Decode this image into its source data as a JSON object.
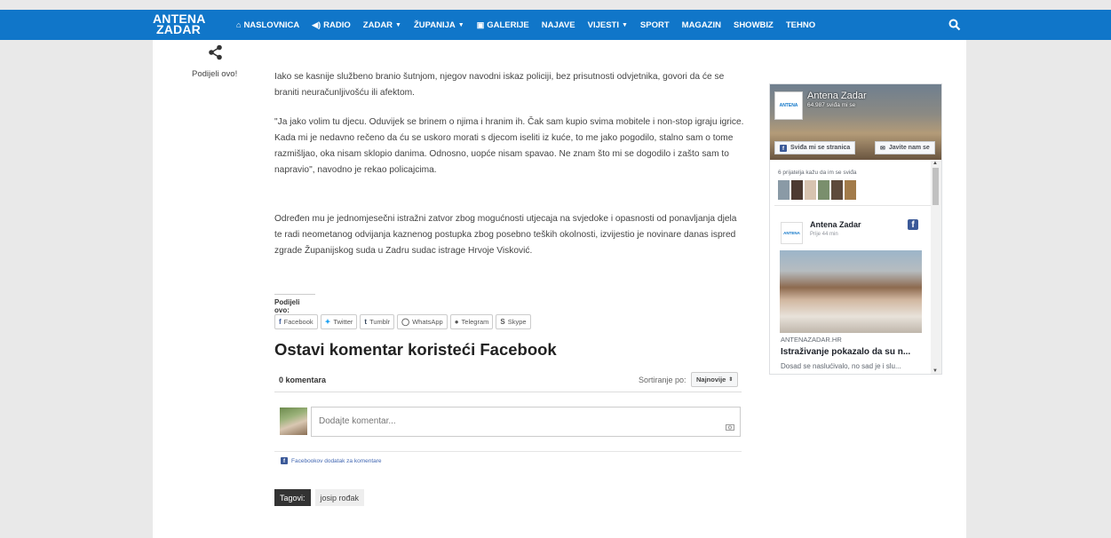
{
  "brand": {
    "line1": "ANTENA",
    "line2": "ZADAR",
    "accent": "#1076c9"
  },
  "nav": {
    "items": [
      {
        "label": "NASLOVNICA",
        "icon": "home-icon"
      },
      {
        "label": "RADIO",
        "icon": "speaker-icon"
      },
      {
        "label": "ZADAR",
        "dropdown": true
      },
      {
        "label": "ŽUPANIJA",
        "dropdown": true
      },
      {
        "label": "GALERIJE",
        "icon": "gallery-icon"
      },
      {
        "label": "NAJAVE"
      },
      {
        "label": "VIJESTI",
        "dropdown": true
      },
      {
        "label": "SPORT"
      },
      {
        "label": "MAGAZIN"
      },
      {
        "label": "SHOWBIZ"
      },
      {
        "label": "TEHNO"
      }
    ],
    "search_icon": "search-icon"
  },
  "share_sidebar": {
    "icon": "share-icon",
    "label": "Podijeli ovo!"
  },
  "article": {
    "paragraphs": [
      "Iako se kasnije službeno branio šutnjom, njegov navodni iskaz policiji, bez prisutnosti odvjetnika, govori da će se braniti neuračunljivošću ili afektom.",
      "\"Ja jako volim tu djecu. Oduvijek se brinem o njima i hranim ih. Čak sam kupio svima mobitele i non-stop igraju igrice. Kada mi je nedavno rečeno da ću se uskoro morati s djecom iseliti iz kuće, to me jako pogodilo, stalno sam o tome razmišljao, oka nisam sklopio danima. Odnosno, uopće nisam spavao. Ne znam što mi se dogodilo i zašto sam to napravio\", navodno je rekao policajcima.",
      "Određen mu je jednomjesečni istražni zatvor zbog mogućnosti utjecaja na svjedoke i opasnosti od ponavljanja djela te radi neometanog odvijanja kaznenog postupka zbog posebno teških okolnosti, izvijestio je novinare danas ispred zgrade Županijskog suda u Zadru sudac istrage Hrvoje Visković."
    ]
  },
  "share_section": {
    "label": "Podijeli ovo:",
    "buttons": [
      {
        "label": "Facebook",
        "icon": "facebook-icon"
      },
      {
        "label": "Twitter",
        "icon": "twitter-icon"
      },
      {
        "label": "Tumblr",
        "icon": "tumblr-icon"
      },
      {
        "label": "WhatsApp",
        "icon": "whatsapp-icon"
      },
      {
        "label": "Telegram",
        "icon": "telegram-icon"
      },
      {
        "label": "Skype",
        "icon": "skype-icon"
      }
    ]
  },
  "comments": {
    "heading": "Ostavi komentar koristeći Facebook",
    "count": "0 komentara",
    "sort_label": "Sortiranje po:",
    "sort_value": "Najnovije",
    "placeholder": "Dodajte komentar...",
    "plugin_link": "Facebookov dodatak za komentare"
  },
  "tags": {
    "label": "Tagovi:",
    "items": [
      "josip rođak"
    ]
  },
  "fb_widget": {
    "page_name": "Antena Zadar",
    "likes": "64.987 sviđa mi se",
    "like_button": "Sviđa mi se stranica",
    "message_button": "Javite nam se",
    "friends_text": "6 prijatelja kažu da im se sviđa",
    "post": {
      "author": "Antena Zadar",
      "time": "Prije 44 min",
      "domain": "ANTENAZADAR.HR",
      "title": "Istraživanje pokazalo da su n...",
      "description": "Dosad se naslućivalo, no sad je i slu..."
    }
  }
}
